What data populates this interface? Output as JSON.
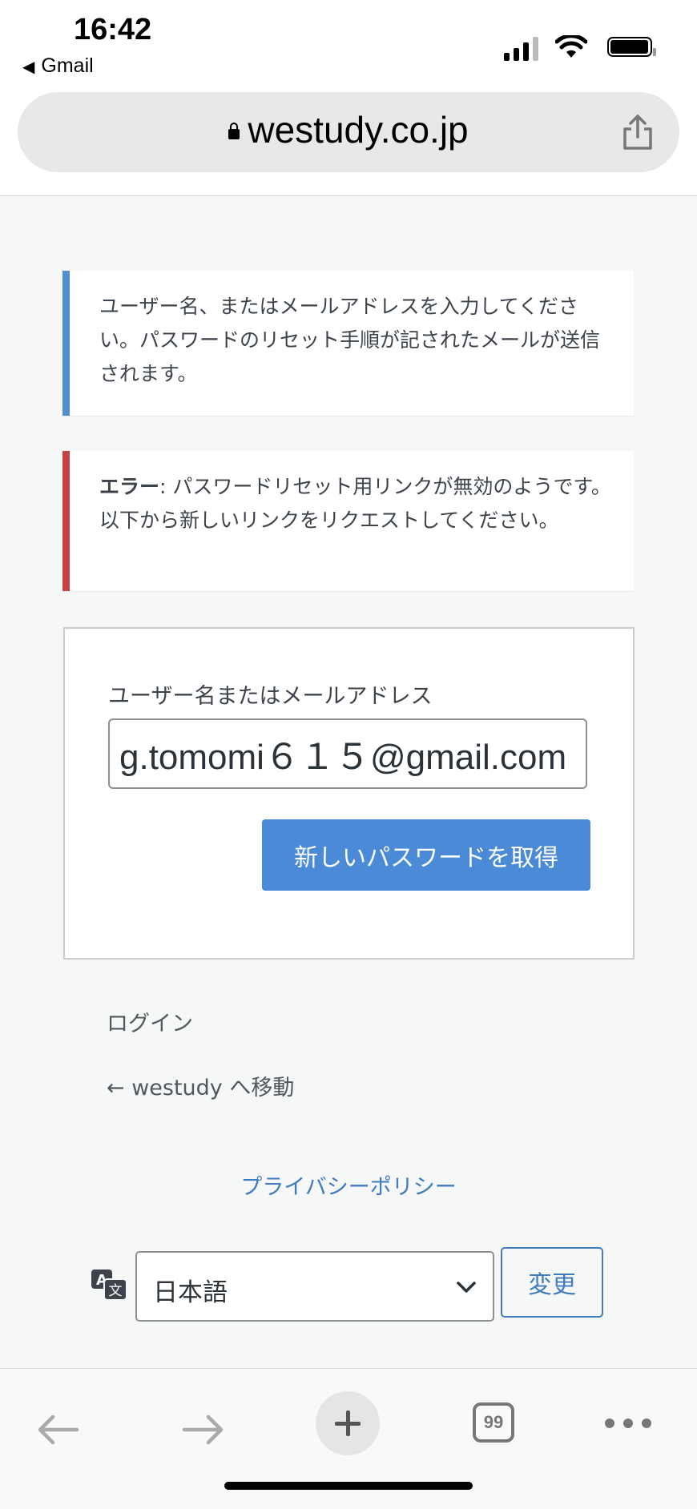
{
  "status_bar": {
    "time": "16:42",
    "back_app": "Gmail"
  },
  "browser": {
    "url": "westudy.co.jp"
  },
  "notices": {
    "info": "ユーザー名、またはメールアドレスを入力してください。パスワードのリセット手順が記されたメールが送信されます。",
    "error_label": "エラー",
    "error_text": ": パスワードリセット用リンクが無効のようです。以下から新しいリンクをリクエストしてください。"
  },
  "form": {
    "label": "ユーザー名またはメールアドレス",
    "value": "g.tomomi６１５@gmail.com",
    "submit_label": "新しいパスワードを取得"
  },
  "links": {
    "login": "ログイン",
    "back_to_site": "← westudy へ移動",
    "privacy": "プライバシーポリシー"
  },
  "language": {
    "selected": "日本語",
    "change_label": "変更"
  },
  "toolbar": {
    "tab_count": "99"
  }
}
